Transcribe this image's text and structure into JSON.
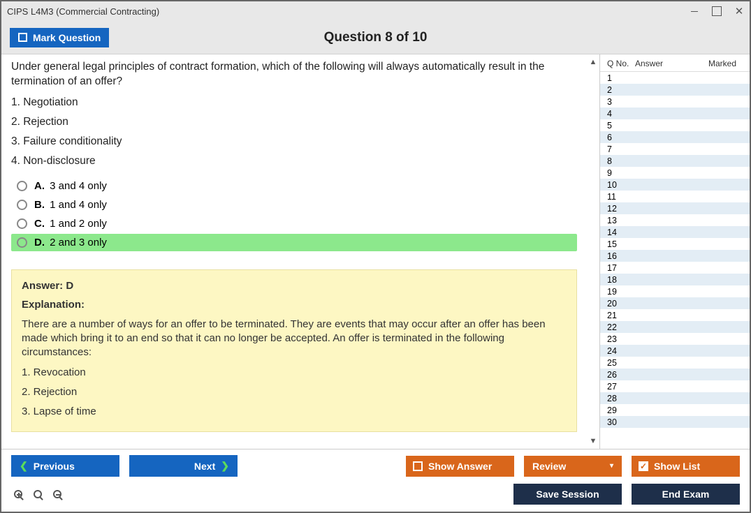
{
  "window": {
    "title": "CIPS L4M3 (Commercial Contracting)"
  },
  "topbar": {
    "mark_label": "Mark Question",
    "question_title": "Question 8 of 10"
  },
  "question": {
    "stem": "Under general legal principles of contract formation, which of the following will always automatically result in the termination of an offer?",
    "numbered_items": [
      "1. Negotiation",
      "2. Rejection",
      "3. Failure conditionality",
      "4. Non-disclosure"
    ],
    "options": [
      {
        "letter": "A.",
        "text": "3 and 4 only",
        "highlight": false
      },
      {
        "letter": "B.",
        "text": "1 and 4 only",
        "highlight": false
      },
      {
        "letter": "C.",
        "text": "1 and 2 only",
        "highlight": false
      },
      {
        "letter": "D.",
        "text": "2 and 3 only",
        "highlight": true
      }
    ]
  },
  "answer": {
    "line": "Answer: D",
    "explanation_label": "Explanation:",
    "paragraph": "There are a number of ways for an offer to be terminated. They are events that may occur after an offer has been made which bring it to an end so that it can no longer be accepted. An offer is terminated in the following circumstances:",
    "list": [
      "1. Revocation",
      "2. Rejection",
      "3. Lapse of time"
    ]
  },
  "sidebar": {
    "headers": {
      "qno": "Q No.",
      "answer": "Answer",
      "marked": "Marked"
    },
    "rows": [
      1,
      2,
      3,
      4,
      5,
      6,
      7,
      8,
      9,
      10,
      11,
      12,
      13,
      14,
      15,
      16,
      17,
      18,
      19,
      20,
      21,
      22,
      23,
      24,
      25,
      26,
      27,
      28,
      29,
      30
    ]
  },
  "footer": {
    "previous": "Previous",
    "next": "Next",
    "show_answer": "Show Answer",
    "review": "Review",
    "show_list": "Show List",
    "save_session": "Save Session",
    "end_exam": "End Exam"
  }
}
